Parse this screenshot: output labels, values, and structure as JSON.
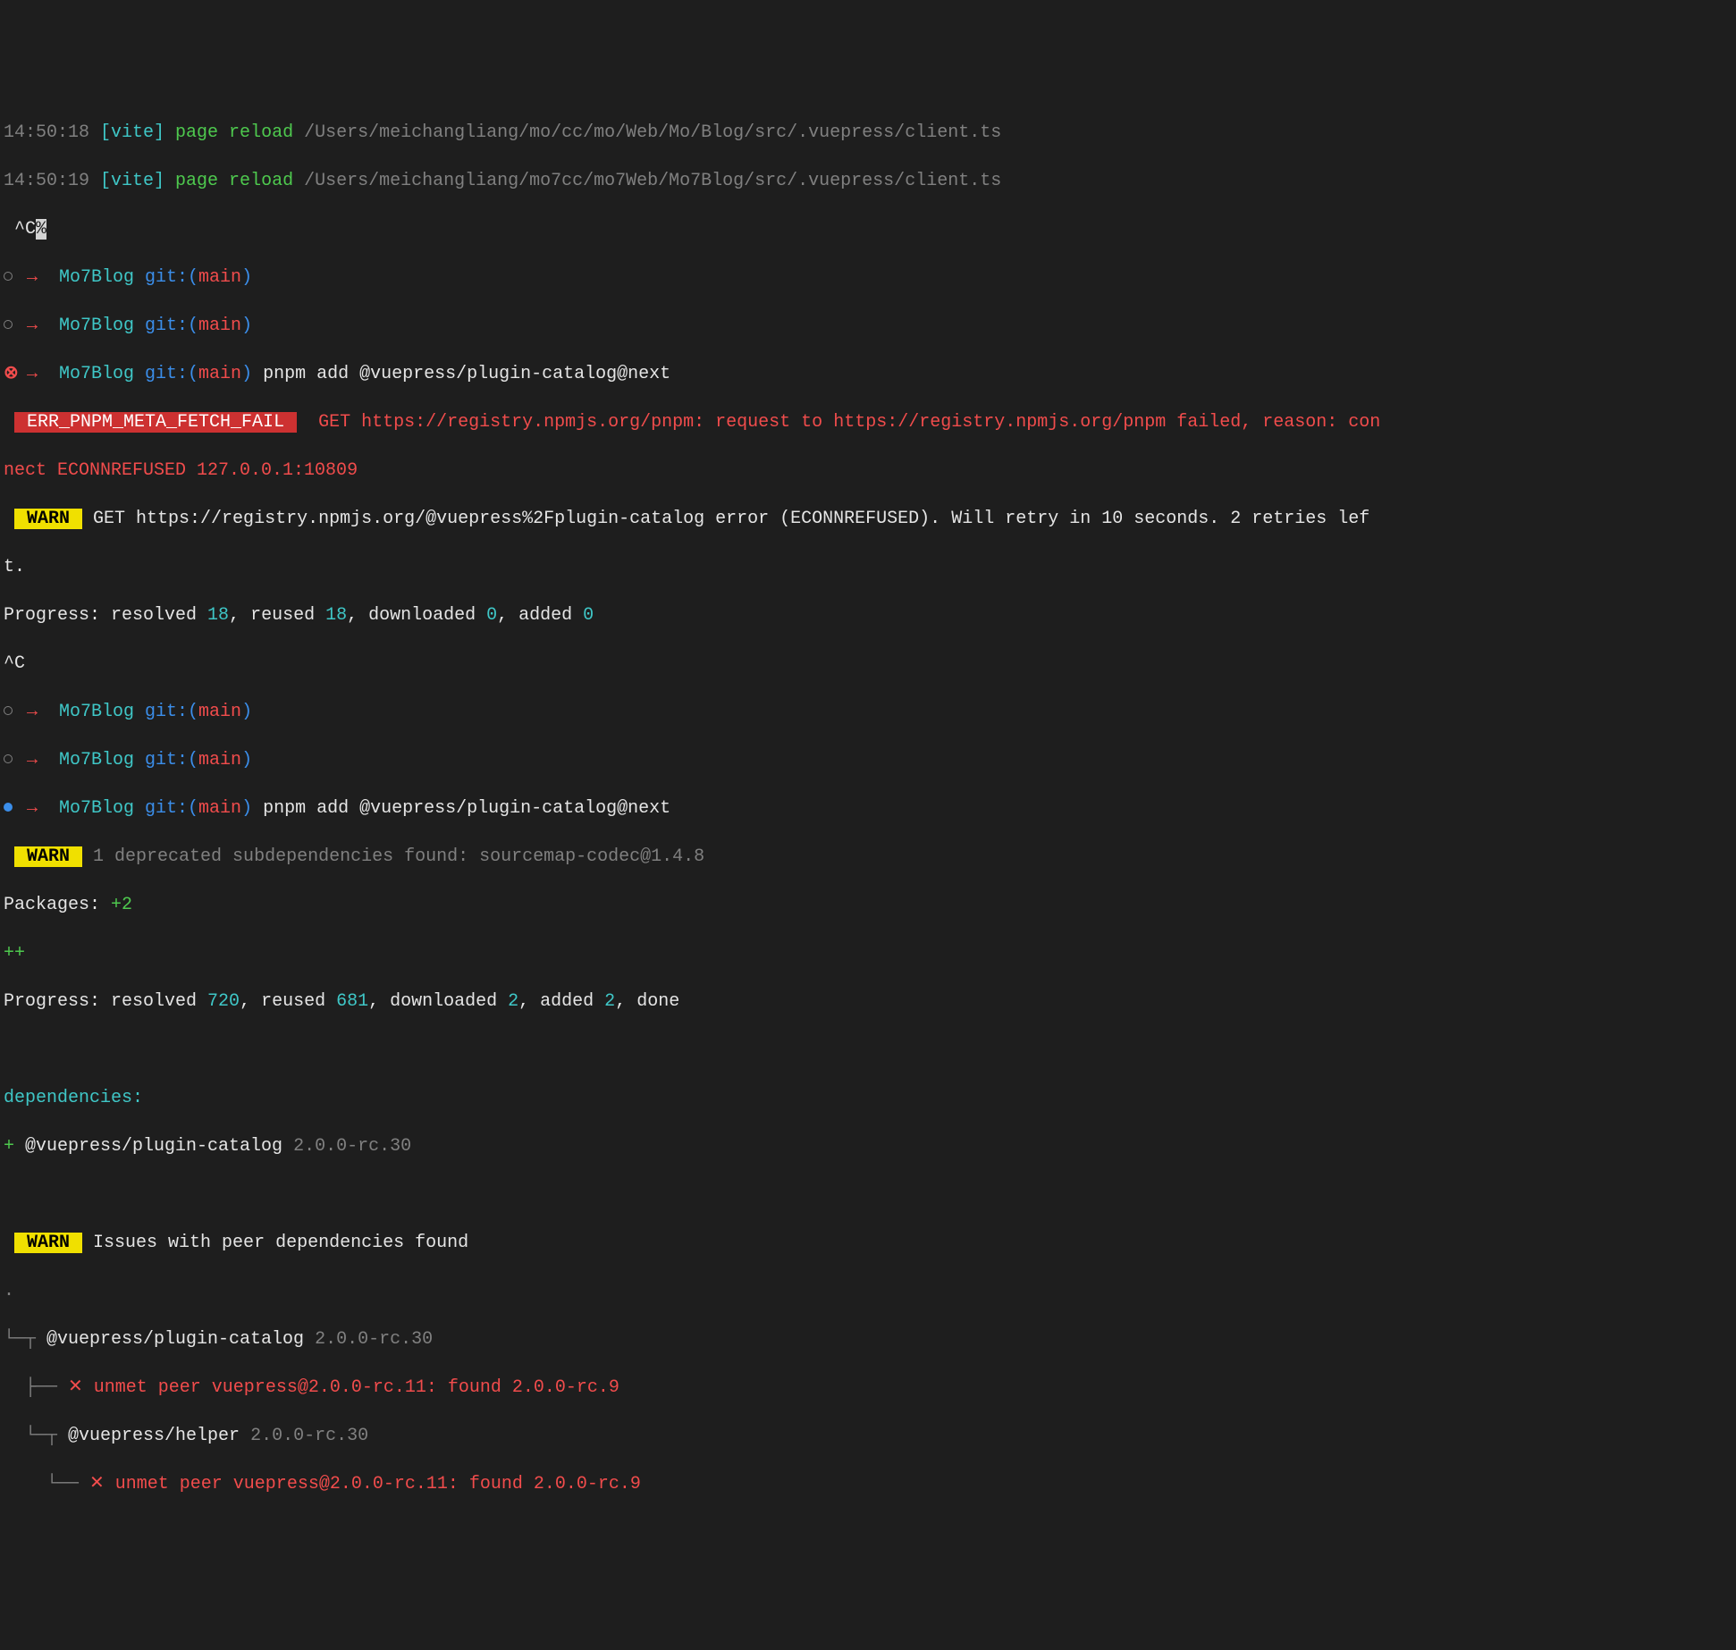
{
  "l1": {
    "ts": "14:50:18 ",
    "tag": "[vite]",
    "msg": " page reload ",
    "path": "/Users/meichangliang/mo/cc/mo/Web/Mo/Blog/src/.vuepress/client.ts"
  },
  "l2": {
    "ts": "14:50:19 ",
    "tag": "[vite]",
    "msg": " page reload ",
    "path": "/Users/meichangliang/mo7cc/mo7Web/Mo7Blog/src/.vuepress/client.ts"
  },
  "l3": {
    "ctrl": "^C",
    "pct": "%"
  },
  "prompt": {
    "arrow": " →  ",
    "dir": "Mo7Blog",
    "git": " git:(",
    "branch": "main",
    "close": ")"
  },
  "cmd1": " pnpm add @vuepress/plugin-catalog@next",
  "err": {
    "badge": " ERR_PNPM_META_FETCH_FAIL ",
    "part1": " GET https://registry.npmjs.org/pnpm: request to https://registry.npmjs.org/pnpm failed, reason: con",
    "part2": "nect ECONNREFUSED 127.0.0.1:10809"
  },
  "warn1": {
    "badge": " WARN ",
    "msg1": " GET https://registry.npmjs.org/@vuepress%2Fplugin-catalog error (ECONNREFUSED). Will retry in 10 seconds. 2 retries lef",
    "msg2": "t."
  },
  "prog1": {
    "p1": "Progress: resolved ",
    "n1": "18",
    "p2": ", reused ",
    "n2": "18",
    "p3": ", downloaded ",
    "n3": "0",
    "p4": ", added ",
    "n4": "0"
  },
  "ctrlc": "^C",
  "cmd2": " pnpm add @vuepress/plugin-catalog@next",
  "warn2": {
    "badge": " WARN ",
    "msg": " 1 deprecated subdependencies found: sourcemap-codec@1.4.8"
  },
  "pkgs": {
    "label": "Packages: ",
    "count": "+2"
  },
  "plus": "++",
  "prog2": {
    "p1": "Progress: resolved ",
    "n1": "720",
    "p2": ", reused ",
    "n2": "681",
    "p3": ", downloaded ",
    "n3": "2",
    "p4": ", added ",
    "n4": "2",
    "done": ", done"
  },
  "deps": {
    "label": "dependencies:",
    "plus": "+ ",
    "name": "@vuepress/plugin-catalog ",
    "ver": "2.0.0-rc.30"
  },
  "warn3": {
    "badge": " WARN ",
    "msg": " Issues with peer dependencies found"
  },
  "tree": {
    "dot": ".",
    "l1_branch": "└─┬ ",
    "l1_name": "@vuepress/plugin-catalog ",
    "l1_ver": "2.0.0-rc.30",
    "l2_branch": "  ├── ",
    "l2_x": "✕ ",
    "l2_msg": "unmet peer vuepress@2.0.0-rc.11: found 2.0.0-rc.9",
    "l3_branch": "  └─┬ ",
    "l3_name": "@vuepress/helper ",
    "l3_ver": "2.0.0-rc.30",
    "l4_branch": "    └── ",
    "l4_x": "✕ ",
    "l4_msg": "unmet peer vuepress@2.0.0-rc.11: found 2.0.0-rc.9"
  }
}
